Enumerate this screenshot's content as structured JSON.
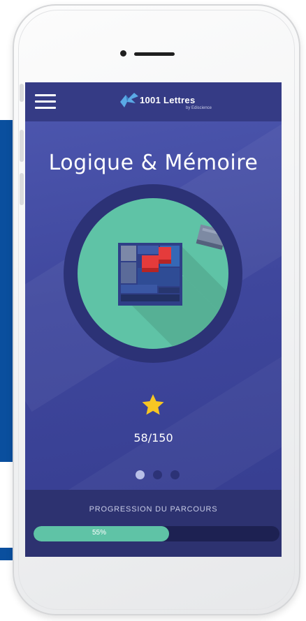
{
  "app": {
    "logo_text": "1001 Lettres",
    "logo_sub": "by Ediscience"
  },
  "screen": {
    "title": "Logique & Mémoire",
    "score": "58/150",
    "pager": {
      "count": 3,
      "active": 0
    }
  },
  "footer": {
    "label": "PROGRESSION DU PARCOURS",
    "progress_text": "55%",
    "progress": 0.55
  },
  "colors": {
    "screen_bg": "#3f479d",
    "header_bg": "#353b85",
    "medal": "#5fc3a6",
    "star": "#f7c623",
    "progress_fill": "#5fc3a6",
    "accent_blue": "#0a4f9e"
  },
  "icons": {
    "menu": "hamburger-menu-icon",
    "logo": "bird-logo-icon",
    "rating": "star-icon",
    "puzzle": "puzzle-blocks-icon"
  }
}
